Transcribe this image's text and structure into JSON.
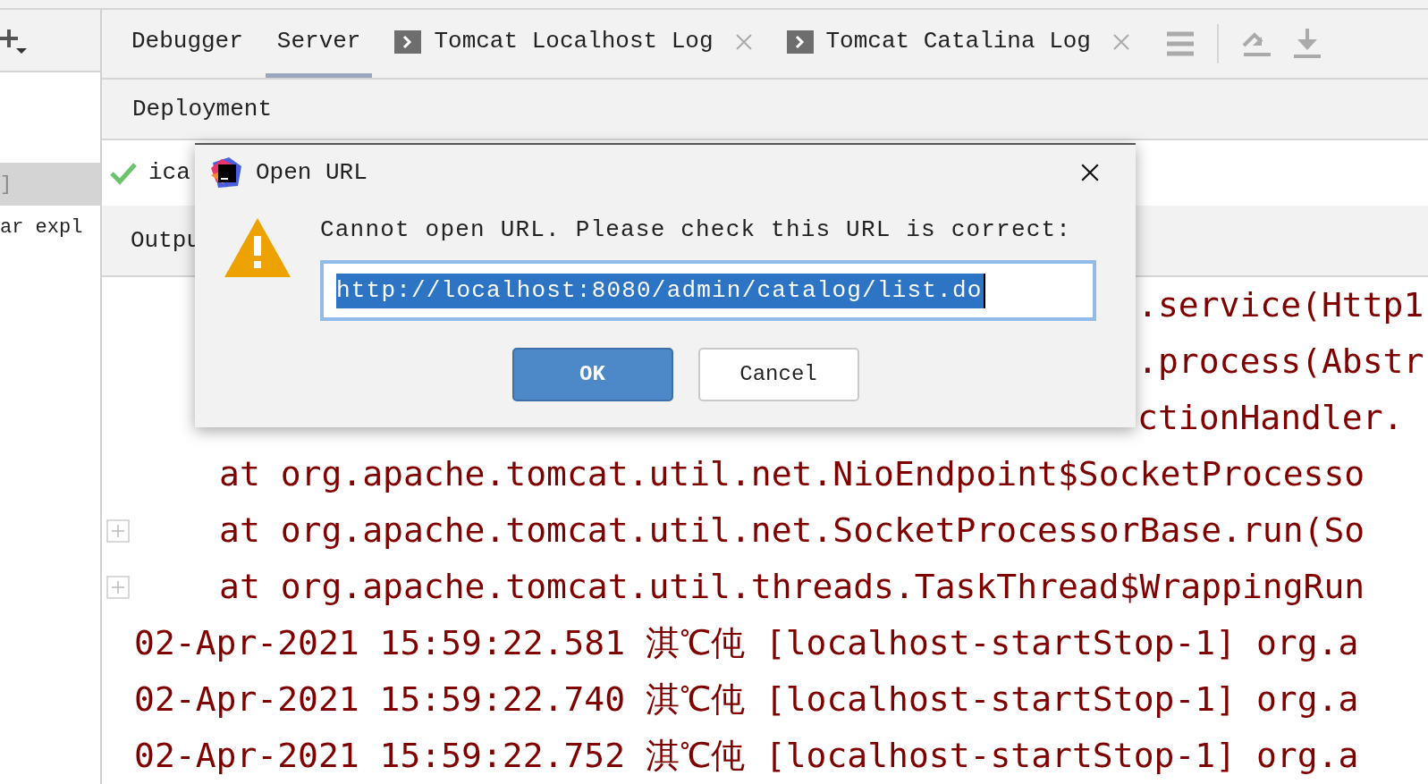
{
  "left_panel": {
    "items": [
      {
        "text": "]",
        "selected": true
      },
      {
        "text": "ar expl",
        "selected": false
      }
    ]
  },
  "tabs": [
    {
      "label": "Debugger",
      "kind": "plain",
      "selected": false,
      "closable": false
    },
    {
      "label": "Server",
      "kind": "plain",
      "selected": true,
      "closable": false
    },
    {
      "label": "Tomcat Localhost Log",
      "kind": "console",
      "selected": false,
      "closable": true
    },
    {
      "label": "Tomcat Catalina Log",
      "kind": "console",
      "selected": false,
      "closable": true
    }
  ],
  "deployment": {
    "header": "Deployment",
    "items": [
      {
        "text": "ica",
        "deployed": true
      }
    ]
  },
  "output": {
    "header": "Outpu"
  },
  "log": [
    {
      "kind": "tail",
      "text": ".service(Http1",
      "foldable": false
    },
    {
      "kind": "tail",
      "text": ".process(Abstr",
      "foldable": false
    },
    {
      "kind": "tail",
      "text": "ctionHandler.",
      "foldable": false
    },
    {
      "kind": "frame",
      "text": "at org.apache.tomcat.util.net.NioEndpoint$SocketProcesso",
      "foldable": false
    },
    {
      "kind": "frame",
      "text": "at org.apache.tomcat.util.net.SocketProcessorBase.run(So",
      "foldable": true
    },
    {
      "kind": "frame",
      "text": "at org.apache.tomcat.util.threads.TaskThread$WrappingRun",
      "foldable": true
    },
    {
      "kind": "entry",
      "text": "02-Apr-2021 15:59:22.581 淇℃伅 [localhost-startStop-1] org.a",
      "foldable": false
    },
    {
      "kind": "entry",
      "text": "02-Apr-2021 15:59:22.740 淇℃伅 [localhost-startStop-1] org.a",
      "foldable": false
    },
    {
      "kind": "entry",
      "text": "02-Apr-2021 15:59:22.752 淇℃伅 [localhost-startStop-1] org.a",
      "foldable": false
    }
  ],
  "dialog": {
    "title": "Open URL",
    "message": "Cannot open URL. Please check this URL is correct:",
    "url": "http://localhost:8080/admin/catalog/list.do",
    "buttons": [
      {
        "label": "OK",
        "default": true
      },
      {
        "label": "Cancel",
        "default": false
      }
    ]
  }
}
